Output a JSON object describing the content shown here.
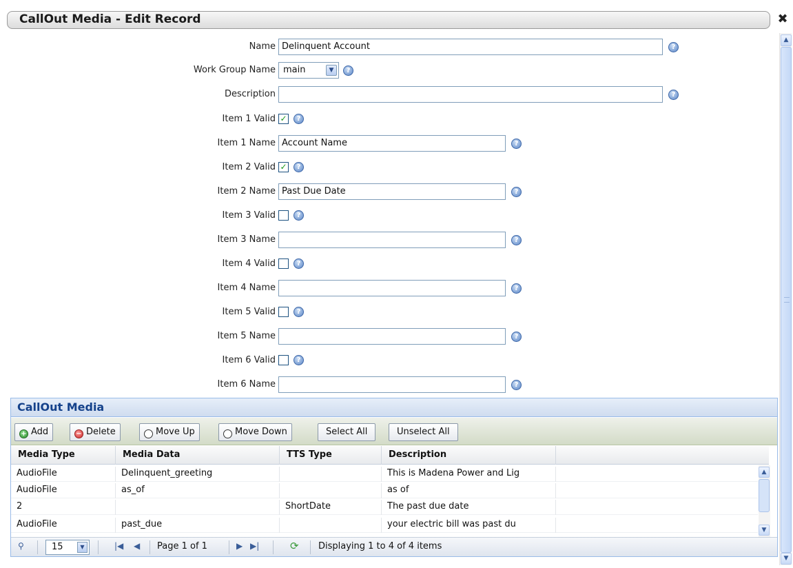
{
  "window": {
    "title": "CallOut Media - Edit Record",
    "close_glyph": "✖"
  },
  "form": {
    "name": {
      "label": "Name",
      "value": "Delinquent Account"
    },
    "work_group": {
      "label": "Work Group Name",
      "value": "main"
    },
    "description": {
      "label": "Description",
      "value": ""
    },
    "items": [
      {
        "valid_label": "Item 1 Valid",
        "valid": true,
        "name_label": "Item 1 Name",
        "name": "Account Name"
      },
      {
        "valid_label": "Item 2 Valid",
        "valid": true,
        "name_label": "Item 2 Name",
        "name": "Past Due Date"
      },
      {
        "valid_label": "Item 3 Valid",
        "valid": false,
        "name_label": "Item 3 Name",
        "name": ""
      },
      {
        "valid_label": "Item 4 Valid",
        "valid": false,
        "name_label": "Item 4 Name",
        "name": ""
      },
      {
        "valid_label": "Item 5 Valid",
        "valid": false,
        "name_label": "Item 5 Name",
        "name": ""
      },
      {
        "valid_label": "Item 6 Valid",
        "valid": false,
        "name_label": "Item 6 Name",
        "name": ""
      }
    ],
    "help_glyph": "?"
  },
  "media_panel": {
    "title": "CallOut Media",
    "toolbar": {
      "add": "Add",
      "delete": "Delete",
      "move_up": "Move Up",
      "move_down": "Move Down",
      "select_all": "Select All",
      "unselect_all": "Unselect All"
    },
    "columns": [
      "Media Type",
      "Media Data",
      "TTS Type",
      "Description"
    ],
    "rows": [
      [
        "AudioFile",
        "Delinquent_greeting",
        "",
        "This is Madena Power and Lig"
      ],
      [
        "AudioFile",
        "as_of",
        "",
        "as of"
      ],
      [
        "2",
        "",
        "ShortDate",
        "The past due date"
      ],
      [
        "AudioFile",
        "past_due",
        "",
        "your electric bill was past du"
      ]
    ],
    "paging": {
      "page_size": "15",
      "page_text": "Page 1 of 1",
      "display_text": "Displaying 1 to 4 of 4 items"
    }
  },
  "colors": {
    "panel_title": "#15428b",
    "panel_border": "#99bbe8",
    "check": "#1e9a1e"
  }
}
